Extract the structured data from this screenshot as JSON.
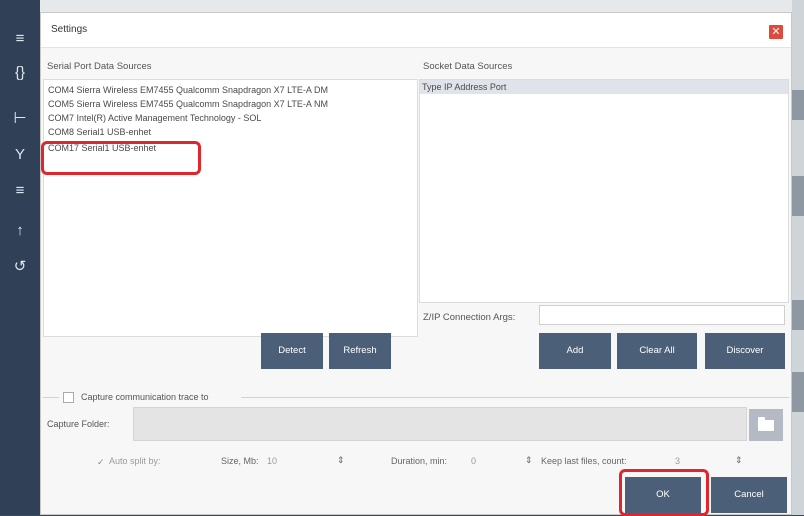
{
  "sidebar": {
    "icons": [
      "list-icon",
      "braces-icon",
      "tree-icon",
      "filter-icon",
      "list-settings-icon",
      "upload-icon",
      "history-icon"
    ]
  },
  "dialog": {
    "title": "Settings",
    "close_glyph": "✕",
    "serial": {
      "label": "Serial Port Data Sources",
      "items": [
        "COM4  Sierra Wireless EM7455 Qualcomm Snapdragon X7 LTE-A DM",
        "COM5  Sierra Wireless EM7455 Qualcomm Snapdragon X7 LTE-A NM",
        "COM7  Intel(R) Active Management Technology - SOL",
        "COM8  Serial1 USB-enhet",
        "COM17 Serial1 USB-enhet"
      ]
    },
    "socket": {
      "label": "Socket Data Sources",
      "header": "Type IP Address Port",
      "conn_args_label": "Z/IP Connection Args:",
      "conn_args_value": ""
    },
    "buttons": {
      "detect": "Detect",
      "refresh": "Refresh",
      "add": "Add",
      "clear_all": "Clear All",
      "discover": "Discover",
      "ok": "OK",
      "cancel": "Cancel"
    },
    "capture": {
      "checkbox_label": "Capture communication trace to",
      "checked": false,
      "folder_label": "Capture Folder:",
      "folder_value": "",
      "auto_split_label": "Auto split by:",
      "size_label": "Size, Mb:",
      "size_value": "10",
      "duration_label": "Duration, min:",
      "duration_value": "0",
      "keep_label": "Keep last files, count:",
      "keep_value": "3",
      "spin_glyph": "⇕"
    }
  },
  "colors": {
    "accent_button": "#4b5f78",
    "highlight": "#e0262d",
    "close": "#e04a3b"
  }
}
